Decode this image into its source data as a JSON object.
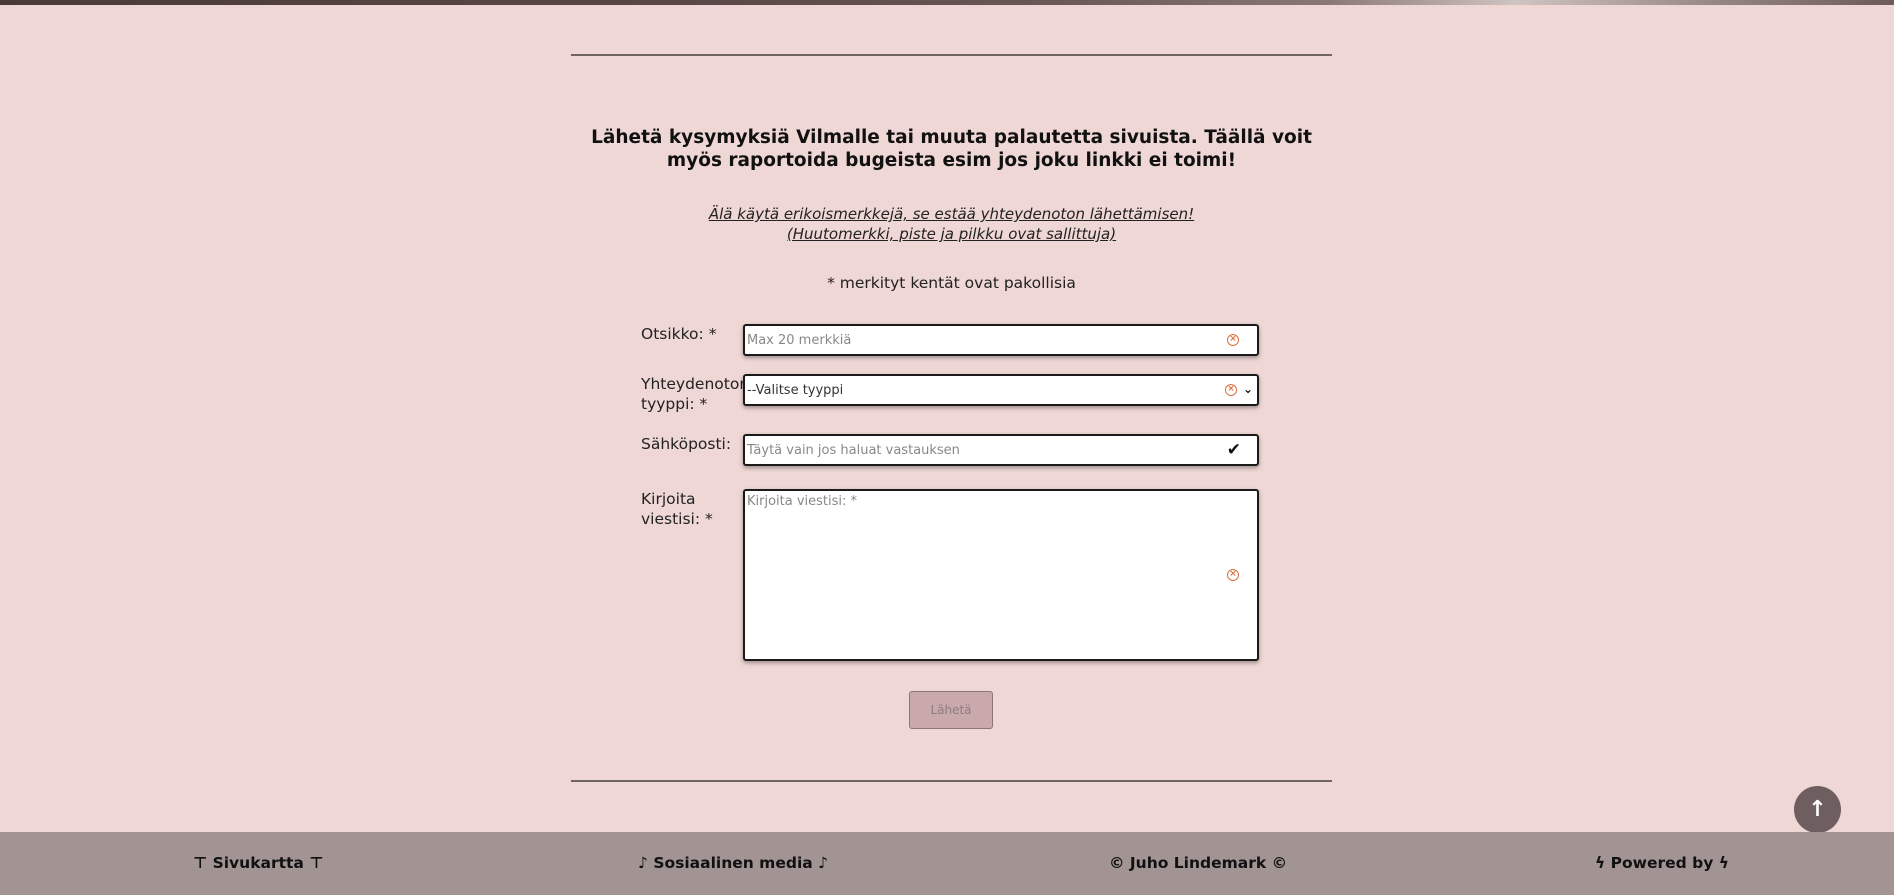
{
  "page": {
    "background": "#efd7d5"
  },
  "header": {
    "heading": "Lähetä kysymyksiä Vilmalle tai muuta palautetta sivuista. Täällä voit myös raportoida bugeista esim jos joku linkki ei toimi!",
    "warning_line1": "Älä käytä erikoismerkkejä, se estää yhteydenoton lähettämisen!",
    "warning_line2": "(Huutomerkki, piste ja pilkku ovat sallittuja)",
    "required_note": "* merkityt kentät ovat pakollisia"
  },
  "form": {
    "title": {
      "label": "Otsikko: *",
      "placeholder": "Max 20 merkkiä",
      "value": "",
      "status_icon": "error-circle-icon"
    },
    "type": {
      "label_line1": "Yhteydenoton",
      "label_line2": "tyyppi: *",
      "selected": "--Valitse tyyppi",
      "status_icon": "error-circle-icon"
    },
    "email": {
      "label": "Sähköposti:",
      "placeholder": "Täytä vain jos haluat vastauksen",
      "value": "",
      "status_icon": "check-icon"
    },
    "message": {
      "label_line1": "Kirjoita",
      "label_line2": "viestisi: *",
      "placeholder": "Kirjoita viestisi: *",
      "value": "",
      "status_icon": "error-circle-icon"
    },
    "submit_label": "Lähetä"
  },
  "footer": {
    "sitemap": "Sivukartta",
    "social": "Sosiaalinen media",
    "copyright": "Juho Lindemark",
    "powered": "Powered by",
    "background": "#a39494"
  },
  "colors": {
    "error_icon": "#d9713f",
    "submit_disabled": "#c9a9ab",
    "scroll_top": "#6e5e60"
  }
}
